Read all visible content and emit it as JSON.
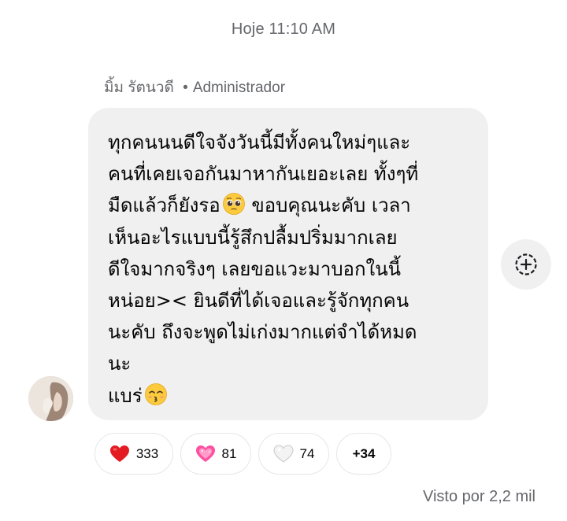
{
  "timestamp": "Hoje 11:10 AM",
  "sender": {
    "name": "มิ้ม รัตนวดี",
    "separator": "•",
    "role": "Administrador"
  },
  "message": {
    "line1": "ทุกคนนนดีใจจังวันนี้มีทั้งคนใหม่ๆและ",
    "line2": "คนที่เคยเจอกันมาหากันเยอะเลย ทั้งๆที่",
    "line3a": "มืดแล้วก็ยังรอ",
    "line3b": " ขอบคุณนะคับ เวลา",
    "line4": "เห็นอะไรแบบนี้รู้สึกปลื้มปริ่มมากเลย",
    "line5": "ดีใจมากจริงๆ เลยขอแวะมาบอกในนี้",
    "line6": "หน่อย>< ยินดีที่ได้เจอและรู้จักทุกคน",
    "line7": "นะคับ ถึงจะพูดไม่เก่งมากแต่จำได้หมด",
    "line8": "นะ",
    "line9": "แบร่",
    "emoji1": "pleading-face",
    "emoji2": "kissing-face-with-smiling-eyes"
  },
  "reactions": [
    {
      "icon": "red-heart",
      "count": "333",
      "color": "#e0245e"
    },
    {
      "icon": "sparkling-heart",
      "count": "81",
      "color": "#ff5fa2"
    },
    {
      "icon": "white-heart",
      "count": "74",
      "color": "#f2f2f2"
    },
    {
      "label": "+34"
    }
  ],
  "seen": "Visto por 2,2 mil"
}
